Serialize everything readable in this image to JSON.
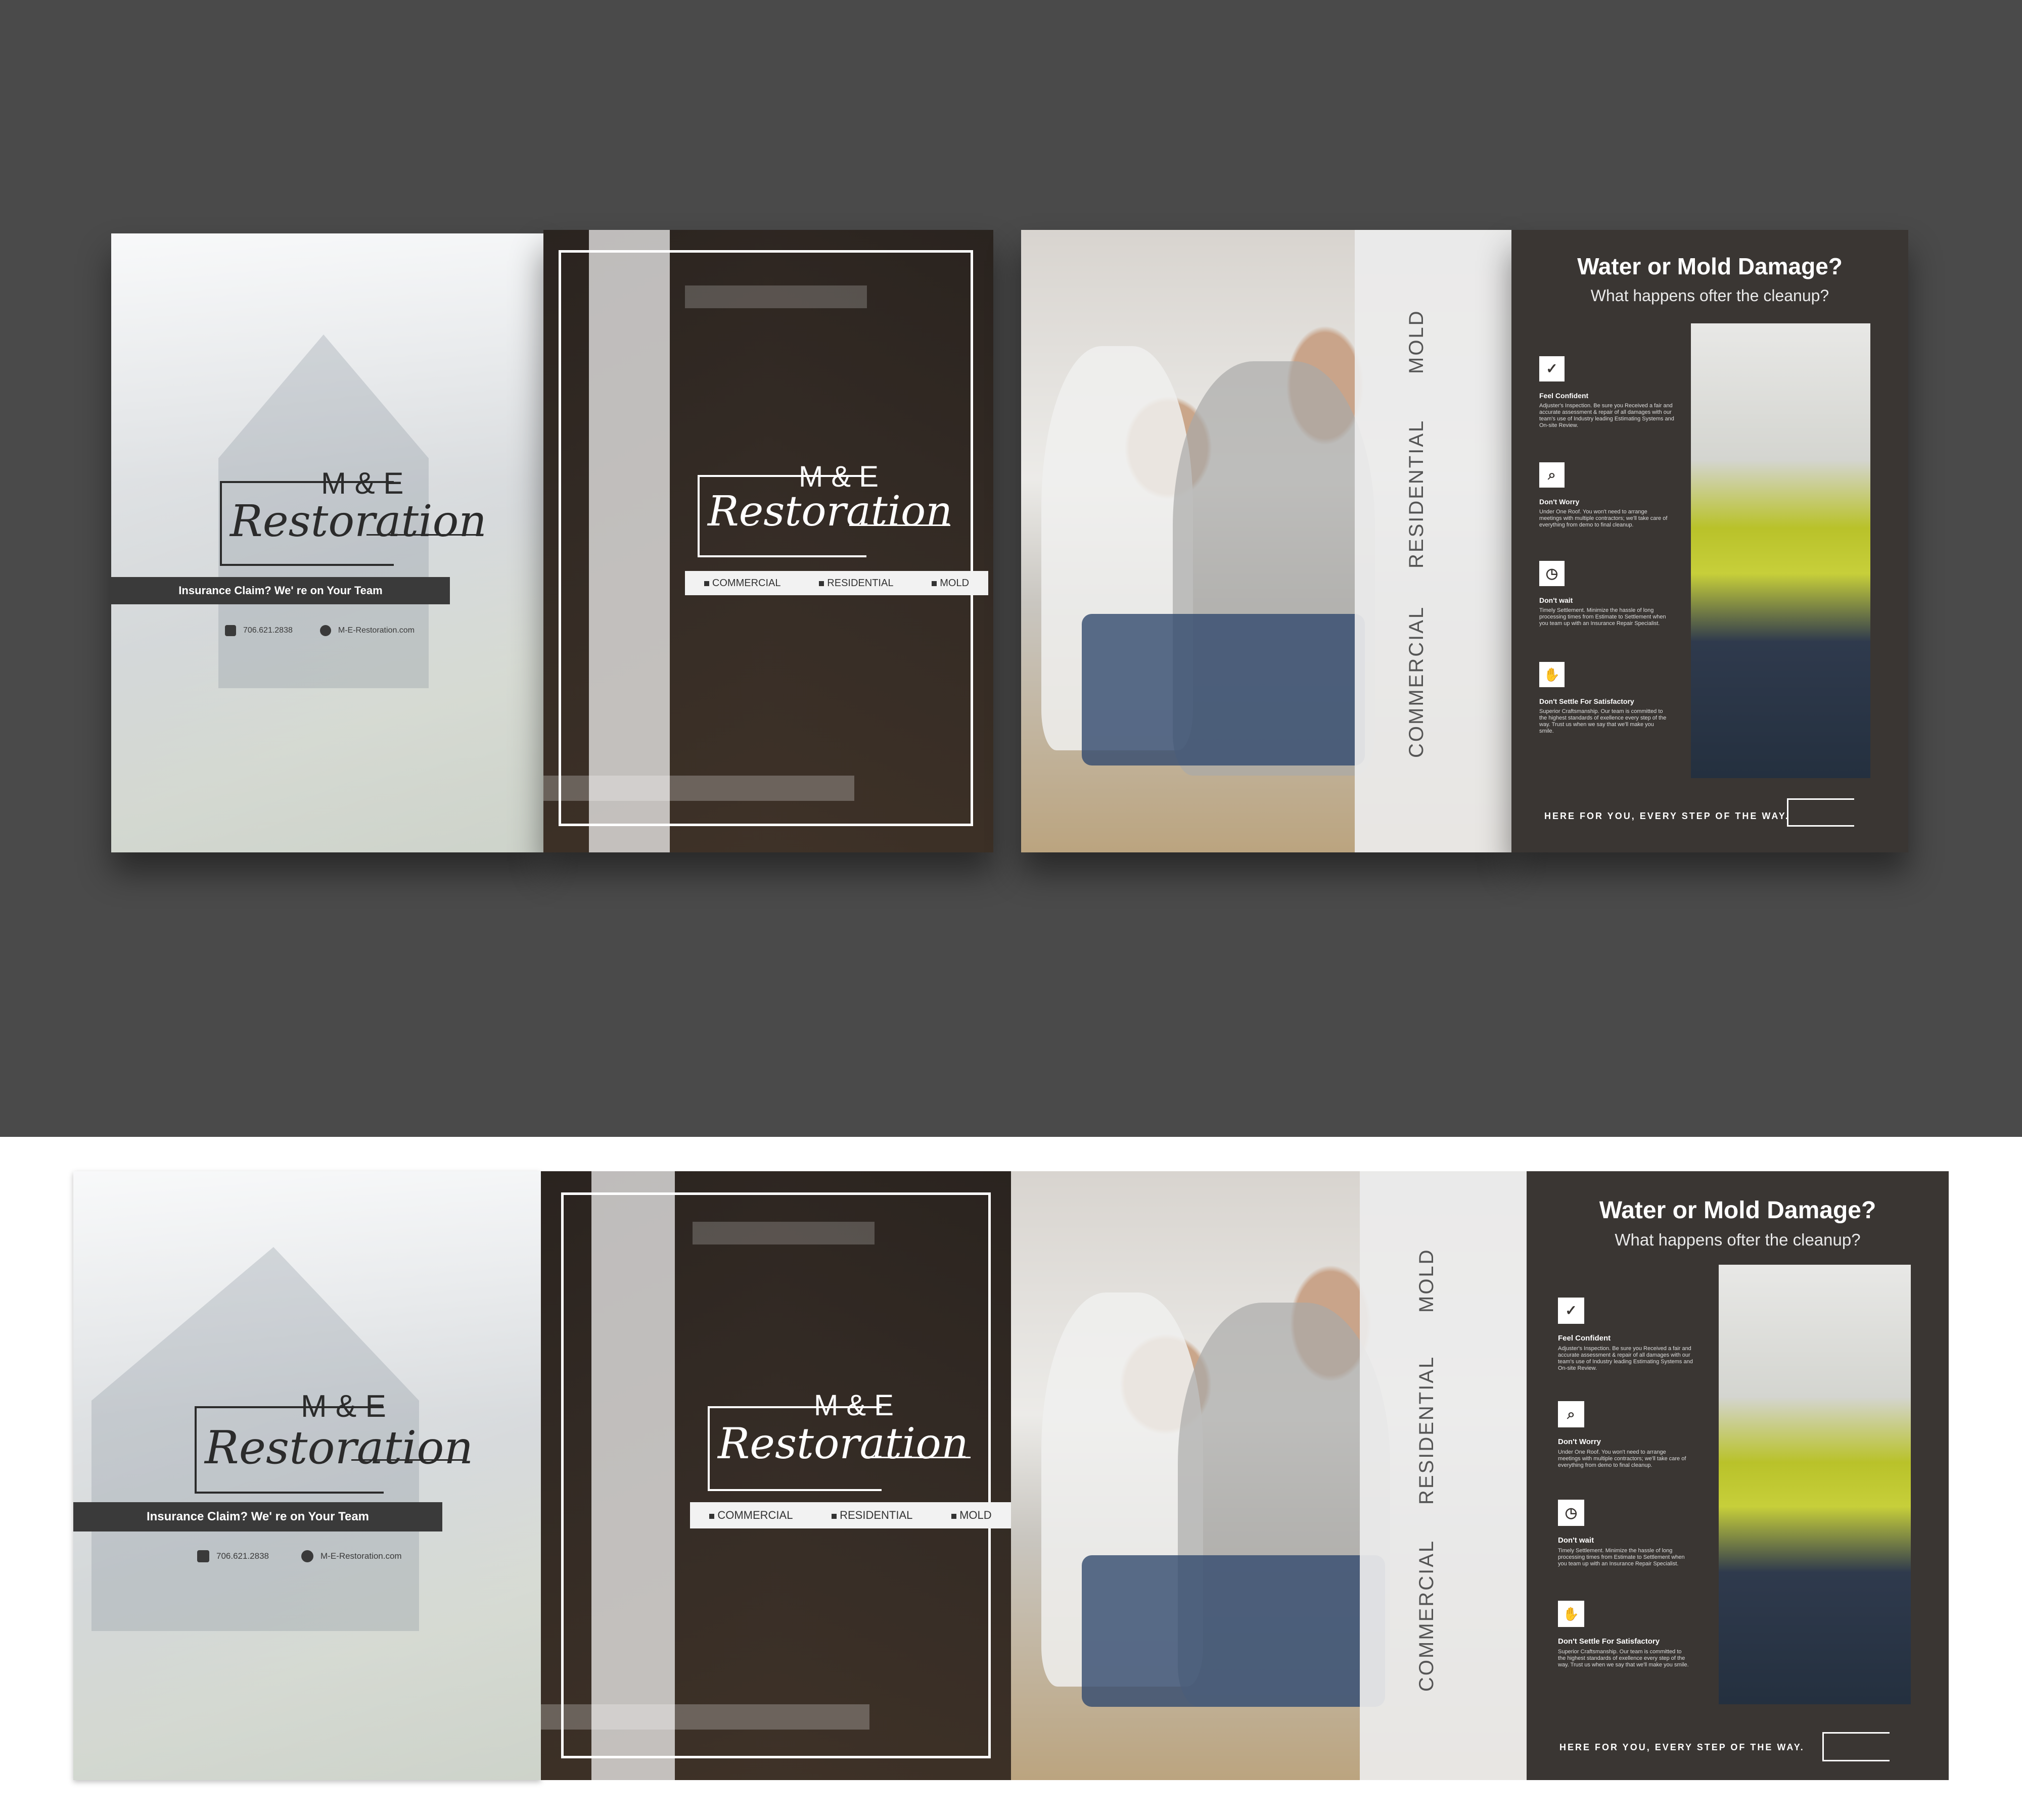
{
  "brand": {
    "me": "M & E",
    "script": "Restoration"
  },
  "cover": {
    "tagline": "Insurance Claim? We' re on Your Team",
    "phone": "706.621.2838",
    "website": "M-E-Restoration.com"
  },
  "services": [
    "COMMERCIAL",
    "RESIDENTIAL",
    "MOLD"
  ],
  "inside": {
    "title": "Water or Mold Damage?",
    "subtitle": "What happens ofter the cleanup?",
    "features": [
      {
        "icon": "confident-icon",
        "heading": "Feel Confident",
        "body": "Adjuster's Inspection. Be sure you Received a fair and accurate assessment & repair of all damages with our team's use of Industry leading Estimating Systems and On-site Review."
      },
      {
        "icon": "magnifier-icon",
        "heading": "Don't Worry",
        "body": "Under One Roof. You won't need to arrange meetings with multiple contractors; we'll take care of everything from demo to final cleanup."
      },
      {
        "icon": "stopwatch-icon",
        "heading": "Don't wait",
        "body": "Timely Settlement. Minimize the hassle of long processing times from Estimate to Settlement when you team up with an Insurance Repair Specialist."
      },
      {
        "icon": "handshake-icon",
        "heading": "Don't Settle For Satisfactory",
        "body": "Superior Craftsmanship. Our team is committed to the highest standards of exellence every step of the way. Trust us when we say that we'll make you smile."
      }
    ],
    "footer": "HERE FOR YOU, EVERY STEP OF THE WAY."
  },
  "colors": {
    "mockup_bg": "#4a4a4a",
    "panel_dark": "#3a3633",
    "tag_bar": "#3a3a3a"
  }
}
